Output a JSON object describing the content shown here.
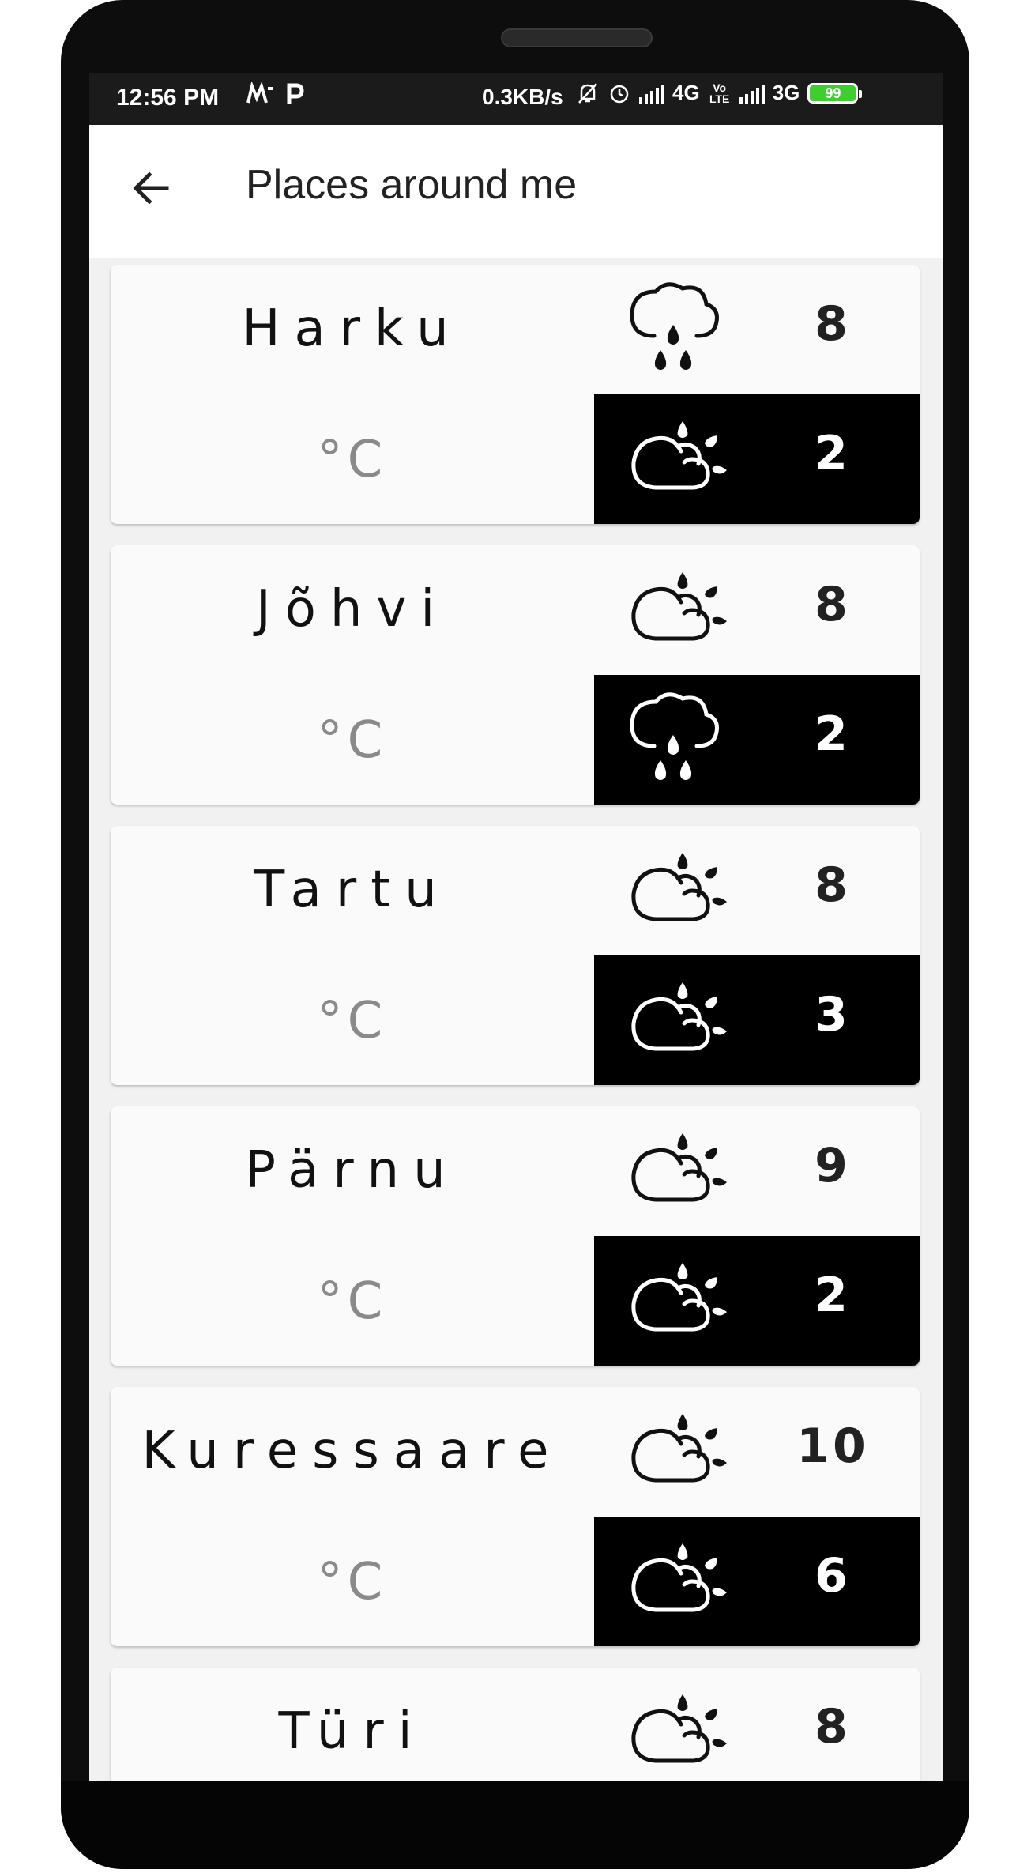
{
  "status_bar": {
    "time": "12:56 PM",
    "left_icons": [
      "mi-icon",
      "p-icon"
    ],
    "speed": "0.3KB/s",
    "network1": "4G",
    "volte": "Vo LTE",
    "network2": "3G",
    "battery": "99"
  },
  "app_bar": {
    "back_icon": "arrow-left-icon",
    "title": "Places around me"
  },
  "places": [
    {
      "name": "Harku",
      "unit": "°C",
      "today": {
        "icon": "rain-icon",
        "temp": "8"
      },
      "tomorrow": {
        "icon": "partly-sunny-icon",
        "temp": "2"
      }
    },
    {
      "name": "Jõhvi",
      "unit": "°C",
      "today": {
        "icon": "partly-sunny-icon",
        "temp": "8"
      },
      "tomorrow": {
        "icon": "rain-icon",
        "temp": "2"
      }
    },
    {
      "name": "Tartu",
      "unit": "°C",
      "today": {
        "icon": "partly-sunny-icon",
        "temp": "8"
      },
      "tomorrow": {
        "icon": "partly-sunny-icon",
        "temp": "3"
      }
    },
    {
      "name": "Pärnu",
      "unit": "°C",
      "today": {
        "icon": "partly-sunny-icon",
        "temp": "9"
      },
      "tomorrow": {
        "icon": "partly-sunny-icon",
        "temp": "2"
      }
    },
    {
      "name": "Kuressaare",
      "unit": "°C",
      "today": {
        "icon": "partly-sunny-icon",
        "temp": "10"
      },
      "tomorrow": {
        "icon": "partly-sunny-icon",
        "temp": "6"
      }
    },
    {
      "name": "Türi",
      "unit": "°C",
      "today": {
        "icon": "partly-sunny-icon",
        "temp": "8"
      },
      "tomorrow": {
        "icon": "partly-sunny-icon",
        "temp": ""
      }
    }
  ]
}
